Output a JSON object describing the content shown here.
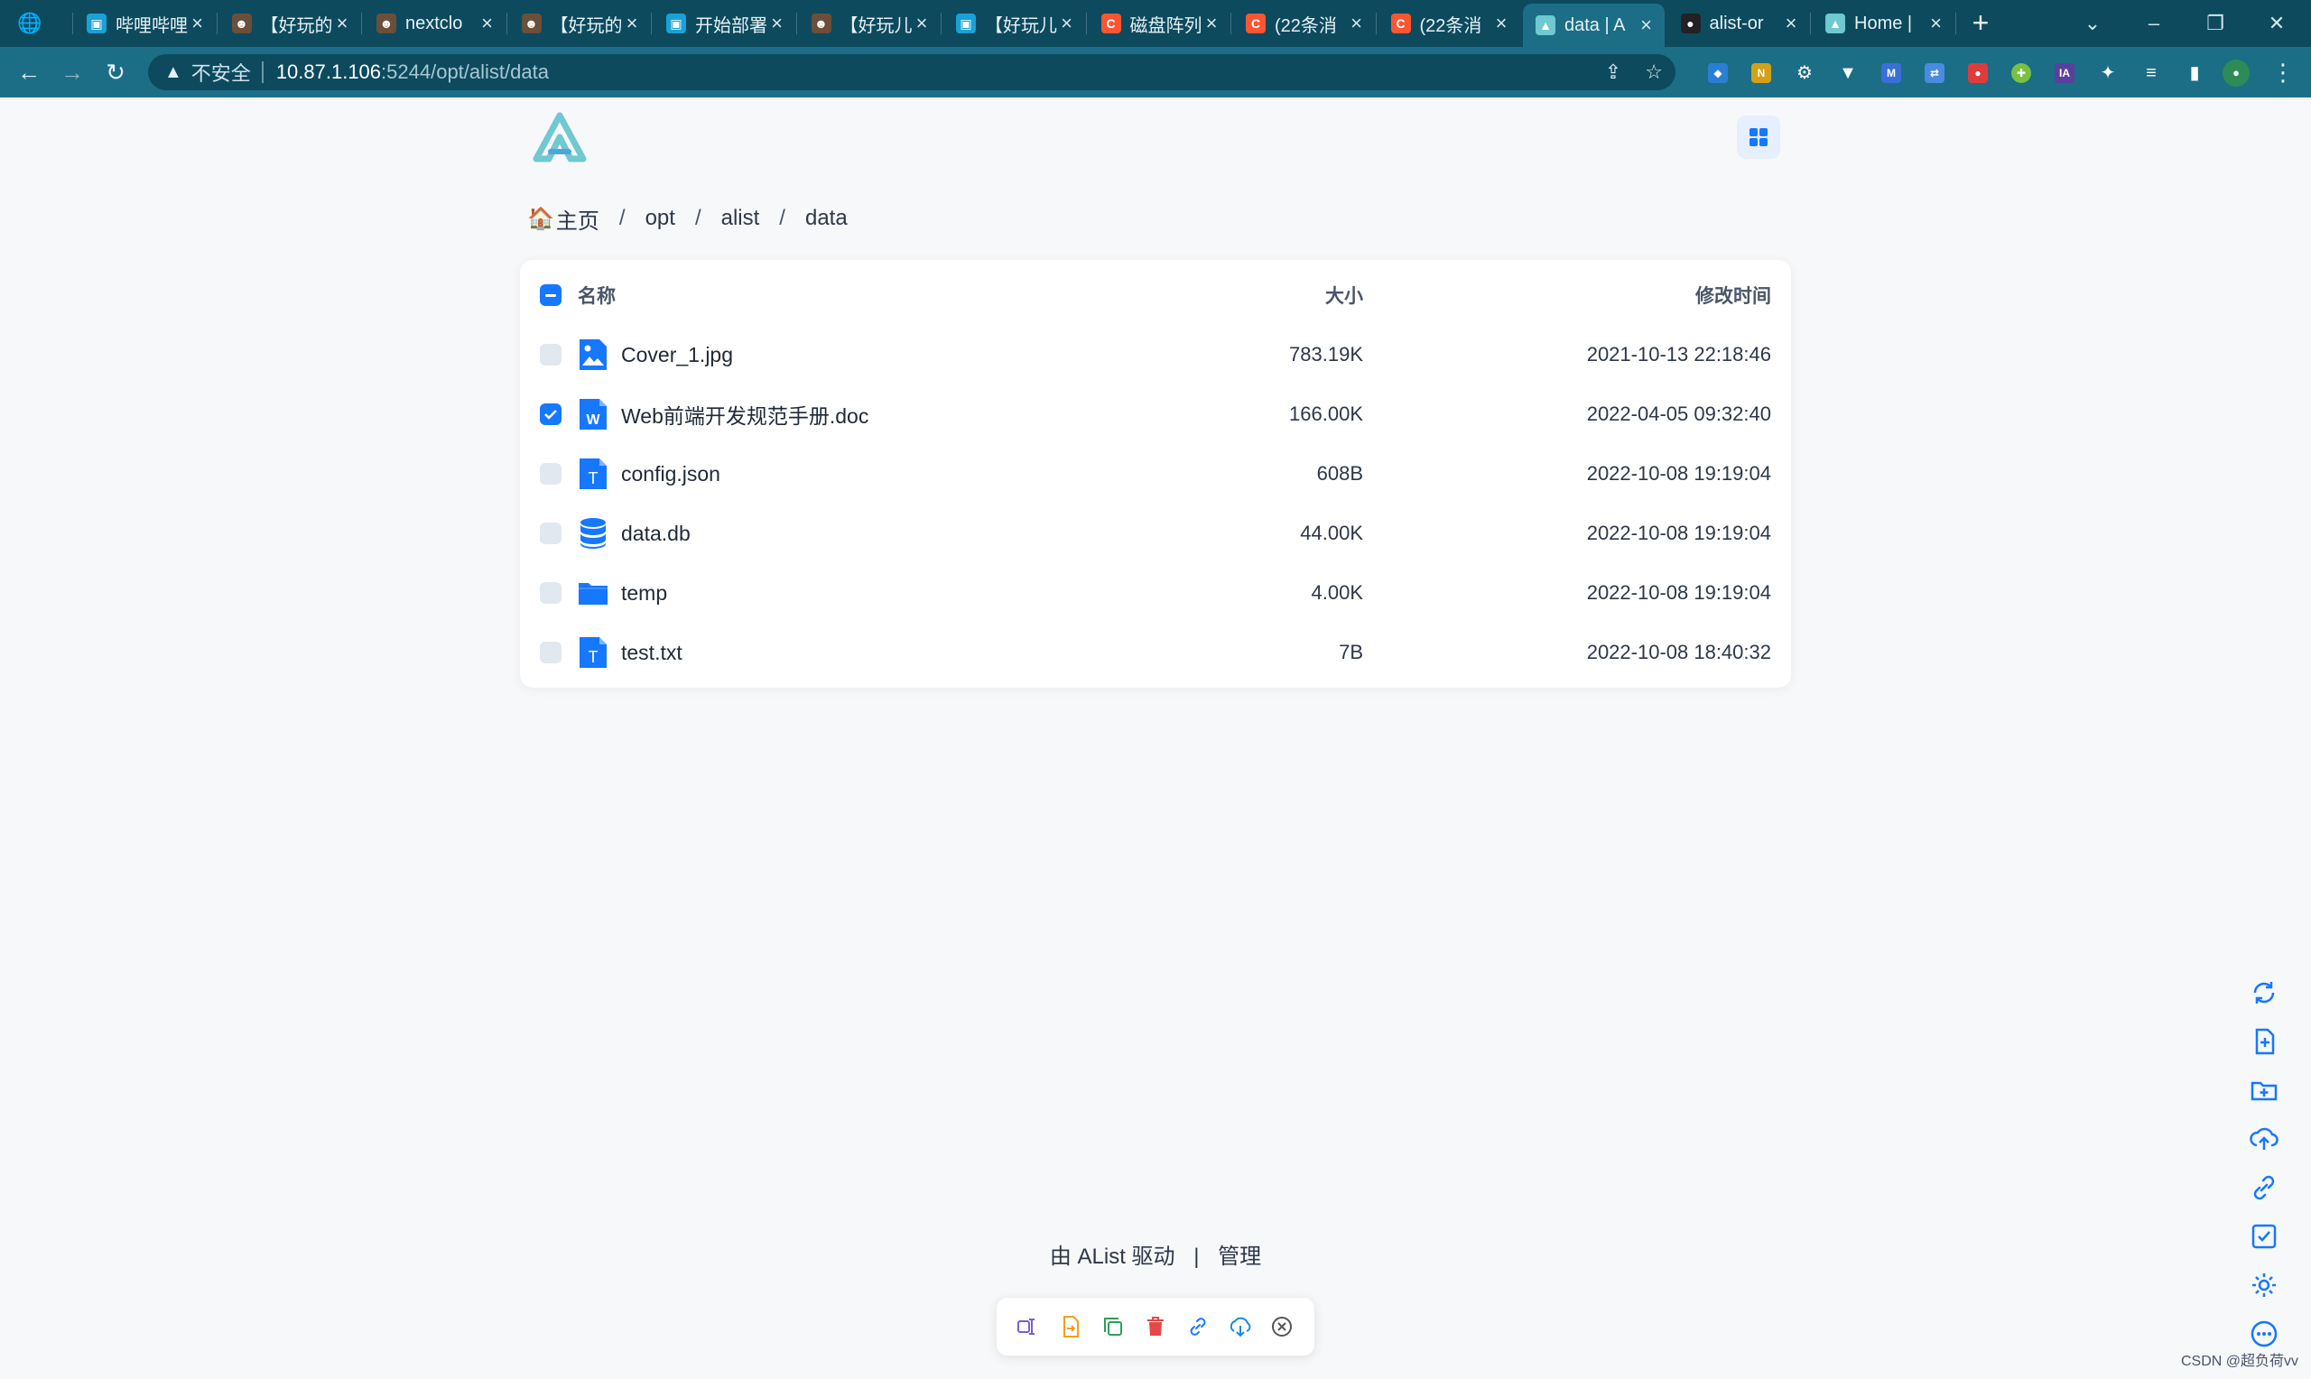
{
  "browser": {
    "tabs": [
      {
        "title": "哔哩哔哩",
        "favicon": "bilibili-icon",
        "color": "#1aa1d6"
      },
      {
        "title": "【好玩的",
        "favicon": "avatar-icon",
        "color": "#6b4f3a"
      },
      {
        "title": "nextclo",
        "favicon": "avatar-icon",
        "color": "#6b4f3a"
      },
      {
        "title": "【好玩的",
        "favicon": "avatar-icon",
        "color": "#6b4f3a"
      },
      {
        "title": "开始部署",
        "favicon": "bilibili-icon",
        "color": "#1aa1d6"
      },
      {
        "title": "【好玩儿",
        "favicon": "avatar-icon",
        "color": "#6b4f3a"
      },
      {
        "title": "【好玩儿",
        "favicon": "bilibili-icon",
        "color": "#1aa1d6"
      },
      {
        "title": "磁盘阵列",
        "favicon": "csdn-icon",
        "color": "#fc5531"
      },
      {
        "title": "(22条消",
        "favicon": "csdn-icon",
        "color": "#fc5531"
      },
      {
        "title": "(22条消",
        "favicon": "csdn-icon",
        "color": "#fc5531"
      },
      {
        "title": "data | A",
        "favicon": "alist-icon",
        "color": "#70c8d0"
      },
      {
        "title": "alist-or",
        "favicon": "github-icon",
        "color": "#222222"
      },
      {
        "title": "Home |",
        "favicon": "alist-icon",
        "color": "#70c8d0"
      }
    ],
    "active_tab": 10,
    "address": {
      "security_label": "不安全",
      "host": "10.87.1.106",
      "path": ":5244/opt/alist/data"
    }
  },
  "breadcrumb": {
    "home": "主页",
    "parts": [
      "opt",
      "alist",
      "data"
    ],
    "separator": "/"
  },
  "table": {
    "headers": {
      "name": "名称",
      "size": "大小",
      "modified": "修改时间"
    },
    "rows": [
      {
        "name": "Cover_1.jpg",
        "size": "783.19K",
        "modified": "2021-10-13 22:18:46",
        "icon": "image-file-icon",
        "checked": false
      },
      {
        "name": "Web前端开发规范手册.doc",
        "size": "166.00K",
        "modified": "2022-04-05 09:32:40",
        "icon": "word-file-icon",
        "checked": true
      },
      {
        "name": "config.json",
        "size": "608B",
        "modified": "2022-10-08 19:19:04",
        "icon": "text-file-icon",
        "checked": false
      },
      {
        "name": "data.db",
        "size": "44.00K",
        "modified": "2022-10-08 19:19:04",
        "icon": "database-icon",
        "checked": false
      },
      {
        "name": "temp",
        "size": "4.00K",
        "modified": "2022-10-08 19:19:04",
        "icon": "folder-icon",
        "checked": false
      },
      {
        "name": "test.txt",
        "size": "7B",
        "modified": "2022-10-08 18:40:32",
        "icon": "text-file-icon",
        "checked": false
      }
    ]
  },
  "footer": {
    "powered_by": "由 AList 驱动",
    "separator": "|",
    "admin_link": "管理"
  },
  "action_bar": [
    "rename-icon",
    "move-icon",
    "copy-icon",
    "delete-icon",
    "link-icon",
    "download-icon",
    "cancel-icon"
  ],
  "right_rail": [
    "refresh-icon",
    "new-file-icon",
    "new-folder-icon",
    "upload-icon",
    "offline-download-icon",
    "select-icon",
    "settings-icon",
    "more-icon"
  ],
  "watermark": "CSDN @超负荷vv",
  "colors": {
    "accent": "#1677ff",
    "chrome_dark": "#0d4a5e",
    "chrome": "#1b6e85",
    "logo": "#70c8d0"
  }
}
